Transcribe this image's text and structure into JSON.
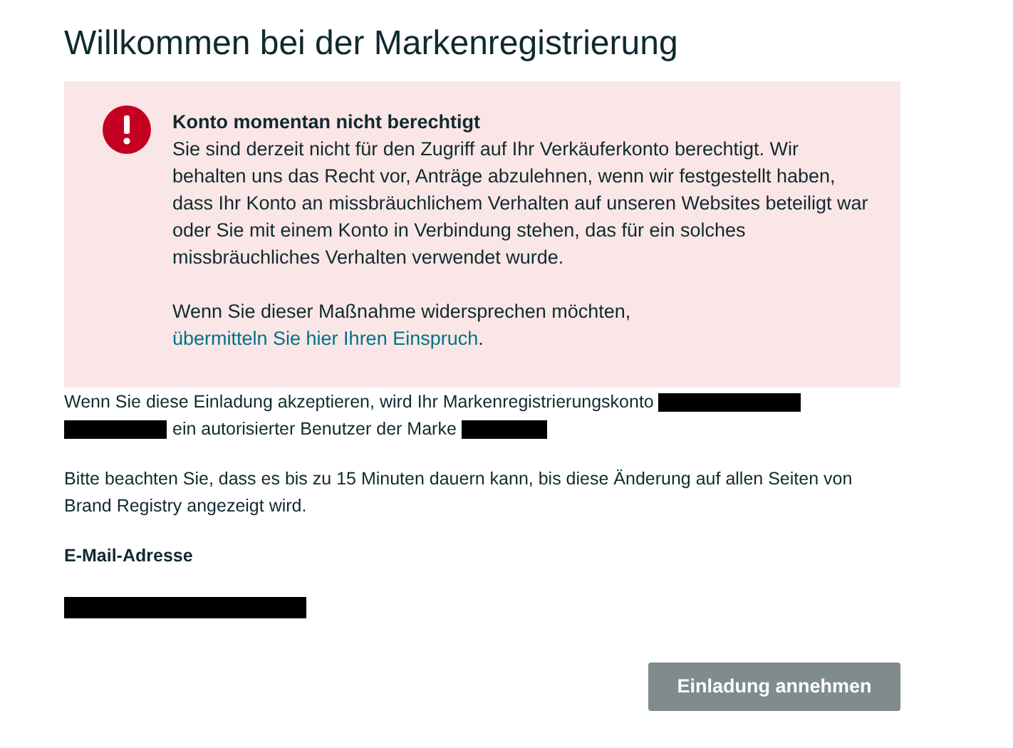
{
  "title": "Willkommen bei der Markenregistrierung",
  "alert": {
    "kind": "error",
    "heading": "Konto momentan nicht berechtigt",
    "body": "Sie sind derzeit nicht für den Zugriff auf Ihr Verkäuferkonto berechtigt. Wir behalten uns das Recht vor, Anträge abzulehnen, wenn wir festgestellt haben, dass Ihr Konto an missbräuchlichem Verhalten auf unseren Websites beteiligt war oder Sie mit einem Konto in Verbindung stehen, das für ein solches missbräuchliches Verhalten verwendet wurde.",
    "appeal_text": "Wenn Sie dieser Maßnahme widersprechen möchten,",
    "appeal_link": "übermitteln Sie hier Ihren Einspruch",
    "appeal_end": "."
  },
  "invite_text": [
    {
      "kind": "text",
      "text": "Wenn Sie diese Einladung akzeptieren, wird Ihr Markenregistrierungskonto"
    },
    {
      "kind": "redacted"
    },
    {
      "kind": "redacted"
    },
    {
      "kind": "text",
      "text": "ein autorisierter Benutzer der Marke"
    },
    {
      "kind": "redacted"
    }
  ],
  "notice": "Bitte beachten Sie, dass es bis zu 15 Minuten dauern kann, bis diese Änderung auf allen Seiten von Brand Registry angezeigt wird.",
  "email": {
    "label": "E-Mail-Adresse",
    "redacted": true
  },
  "accept_button": {
    "label": "Einladung annehmen",
    "disabled": true
  }
}
